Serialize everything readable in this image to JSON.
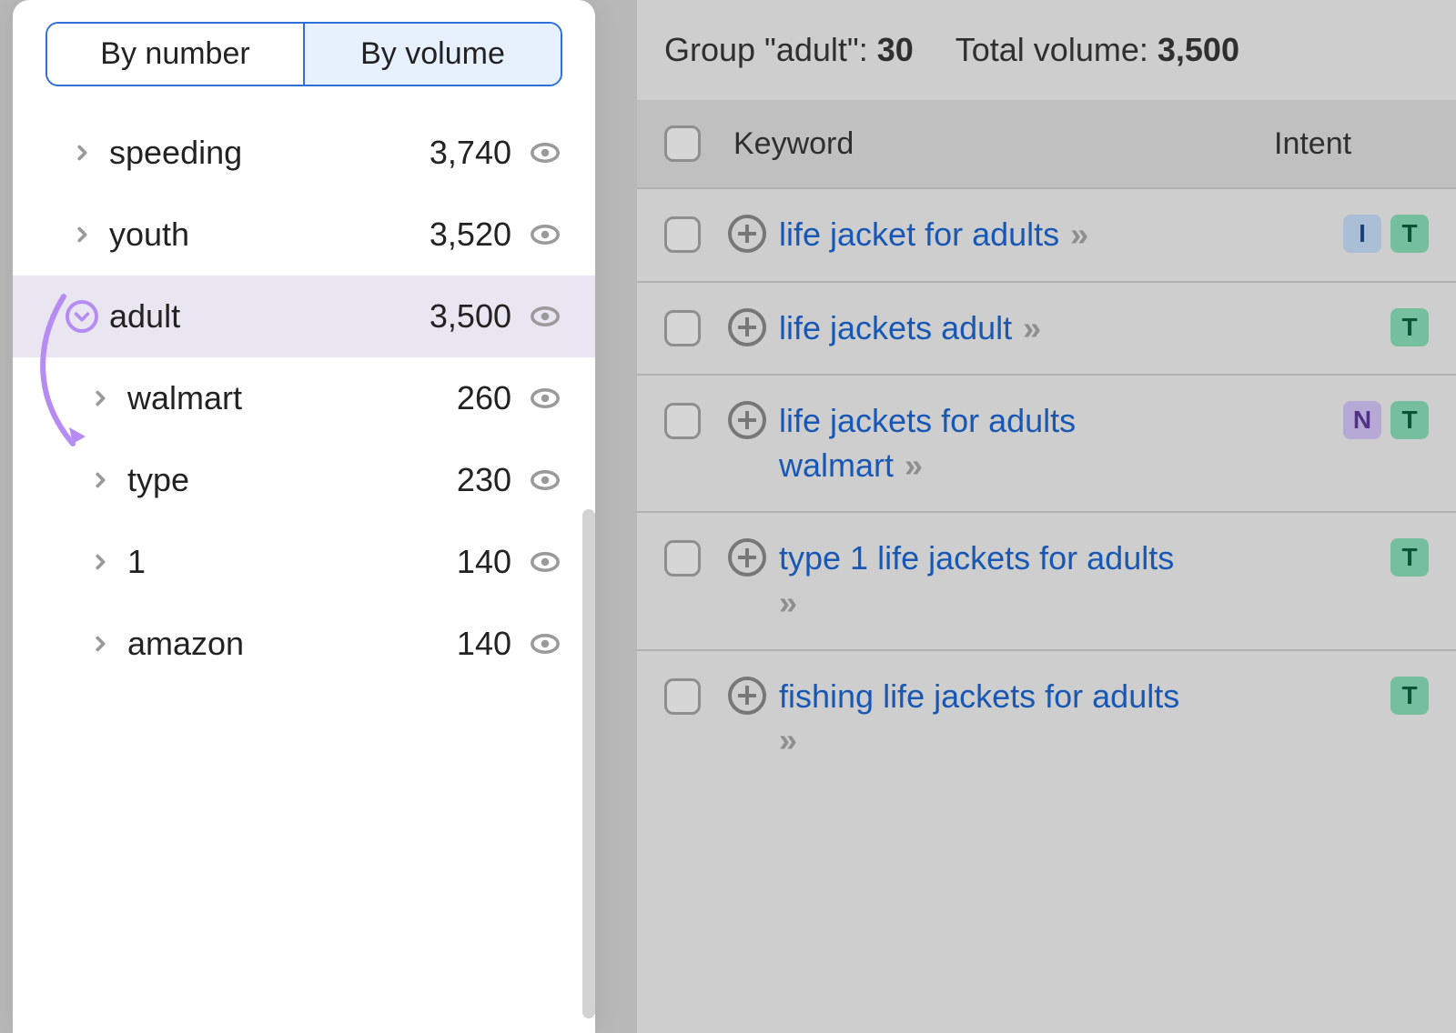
{
  "sidebar": {
    "tabs": {
      "by_number": "By number",
      "by_volume": "By volume"
    },
    "groups": [
      {
        "label": "speeding",
        "value": "3,740",
        "expanded": false,
        "selected": false,
        "child": false,
        "highlight": false
      },
      {
        "label": "youth",
        "value": "3,520",
        "expanded": false,
        "selected": false,
        "child": false,
        "highlight": false
      },
      {
        "label": "adult",
        "value": "3,500",
        "expanded": true,
        "selected": true,
        "child": false,
        "highlight": true
      },
      {
        "label": "walmart",
        "value": "260",
        "expanded": false,
        "selected": false,
        "child": true,
        "highlight": false
      },
      {
        "label": "type",
        "value": "230",
        "expanded": false,
        "selected": false,
        "child": true,
        "highlight": false
      },
      {
        "label": "1",
        "value": "140",
        "expanded": false,
        "selected": false,
        "child": true,
        "highlight": false
      },
      {
        "label": "amazon",
        "value": "140",
        "expanded": false,
        "selected": false,
        "child": true,
        "highlight": false
      }
    ]
  },
  "main": {
    "header": {
      "group_label_prefix": "Group \"",
      "group_name": "adult",
      "group_label_suffix": "\": ",
      "group_count": "30",
      "total_volume_label": "Total volume: ",
      "total_volume_value": "3,500"
    },
    "columns": {
      "keyword": "Keyword",
      "intent": "Intent"
    },
    "rows": [
      {
        "text": "life jacket for adults",
        "intents": [
          "I",
          "T"
        ]
      },
      {
        "text": "life jackets adult",
        "intents": [
          "T"
        ]
      },
      {
        "text": "life jackets for adults walmart",
        "intents": [
          "N",
          "T"
        ]
      },
      {
        "text": "type 1 life jackets for adults",
        "intents": [
          "T"
        ]
      },
      {
        "text": "fishing life jackets for adults",
        "intents": [
          "T"
        ]
      }
    ]
  }
}
